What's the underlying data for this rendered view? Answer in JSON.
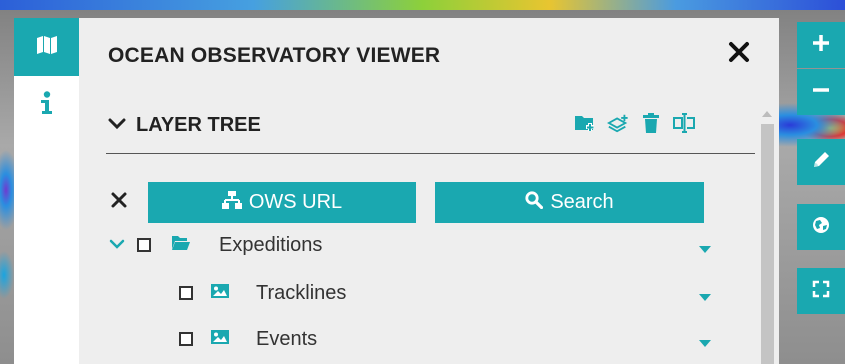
{
  "panel": {
    "title": "OCEAN OBSERVATORY VIEWER",
    "close_icon": "close-icon"
  },
  "tabs": [
    {
      "icon": "map-icon",
      "active": true
    },
    {
      "icon": "info-icon",
      "active": false
    }
  ],
  "layer_tree": {
    "title": "LAYER TREE",
    "expanded": true,
    "tools": [
      "add-folder-icon",
      "add-layer-icon",
      "trash-icon",
      "rename-icon"
    ],
    "ows_button_label": "OWS URL",
    "search_button_label": "Search",
    "items": [
      {
        "label": "Expeditions",
        "type": "folder",
        "expanded": true,
        "checked": false
      },
      {
        "label": "Tracklines",
        "type": "layer",
        "checked": false
      },
      {
        "label": "Events",
        "type": "layer",
        "checked": false
      }
    ]
  },
  "map_controls": [
    "zoom-in-icon",
    "zoom-out-icon",
    "pencil-icon",
    "globe-icon",
    "fullscreen-icon"
  ],
  "colors": {
    "accent": "#1aa8b0",
    "panel_bg": "#eeeeee",
    "text": "#222222"
  }
}
